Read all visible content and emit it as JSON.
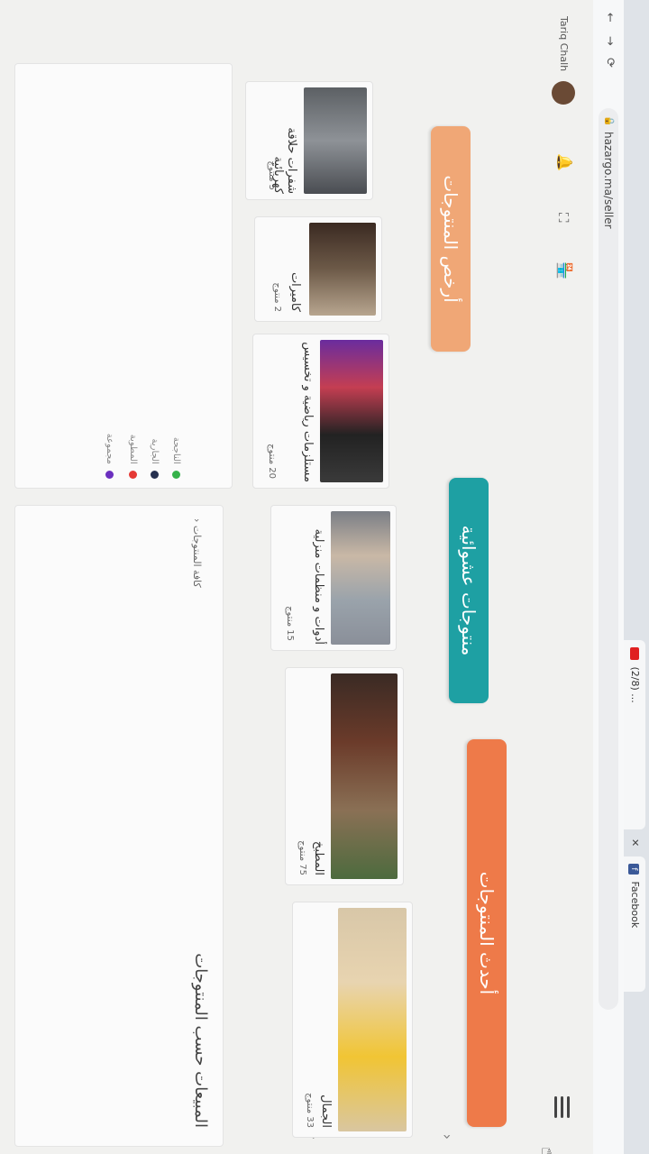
{
  "browser": {
    "tabs": [
      {
        "label": "Facebook",
        "icon": "facebook-icon"
      },
      {
        "label": "(2/8) ..."
      }
    ],
    "url": "hazargo.ma/seller",
    "user_name": "Tariq Chalh"
  },
  "colors": {
    "orange": "#ee7a49",
    "teal": "#1ea0a3",
    "light_orange": "#f0a06a",
    "legend_purple": "#6b2fbf",
    "legend_red": "#e53935",
    "legend_navy": "#263050",
    "legend_green": "#35b24a"
  },
  "buttons": {
    "latest_products": "أحدث المنتوجات",
    "random_products": "منتوجات عشوائية",
    "cheapest_products": "أرخص المنتوجات"
  },
  "categories": [
    {
      "name": "الجمال",
      "count": "33 منتوج"
    },
    {
      "name": "المطبخ",
      "count": "75 منتوج"
    },
    {
      "name": "أدوات و منظمات منزلية",
      "count": "15 منتوج"
    },
    {
      "name": "مستلزمات رياضية و تخسيس",
      "count": "20 منتوج"
    },
    {
      "name": "كاميرات",
      "count": "2 منتوج"
    },
    {
      "name": "شفرات حلاقة كهربائية",
      "count": "5 منتوج"
    }
  ],
  "sales_panel": {
    "title": "المبيعات حسب المنتوجات",
    "link": "كافة المنتوجات"
  },
  "legend": [
    {
      "label": "مجموعة",
      "color": "#6b2fbf"
    },
    {
      "label": "المطوبة",
      "color": "#e53935"
    },
    {
      "label": "الجارية",
      "color": "#263050"
    },
    {
      "label": "الناجحة",
      "color": "#35b24a"
    }
  ]
}
